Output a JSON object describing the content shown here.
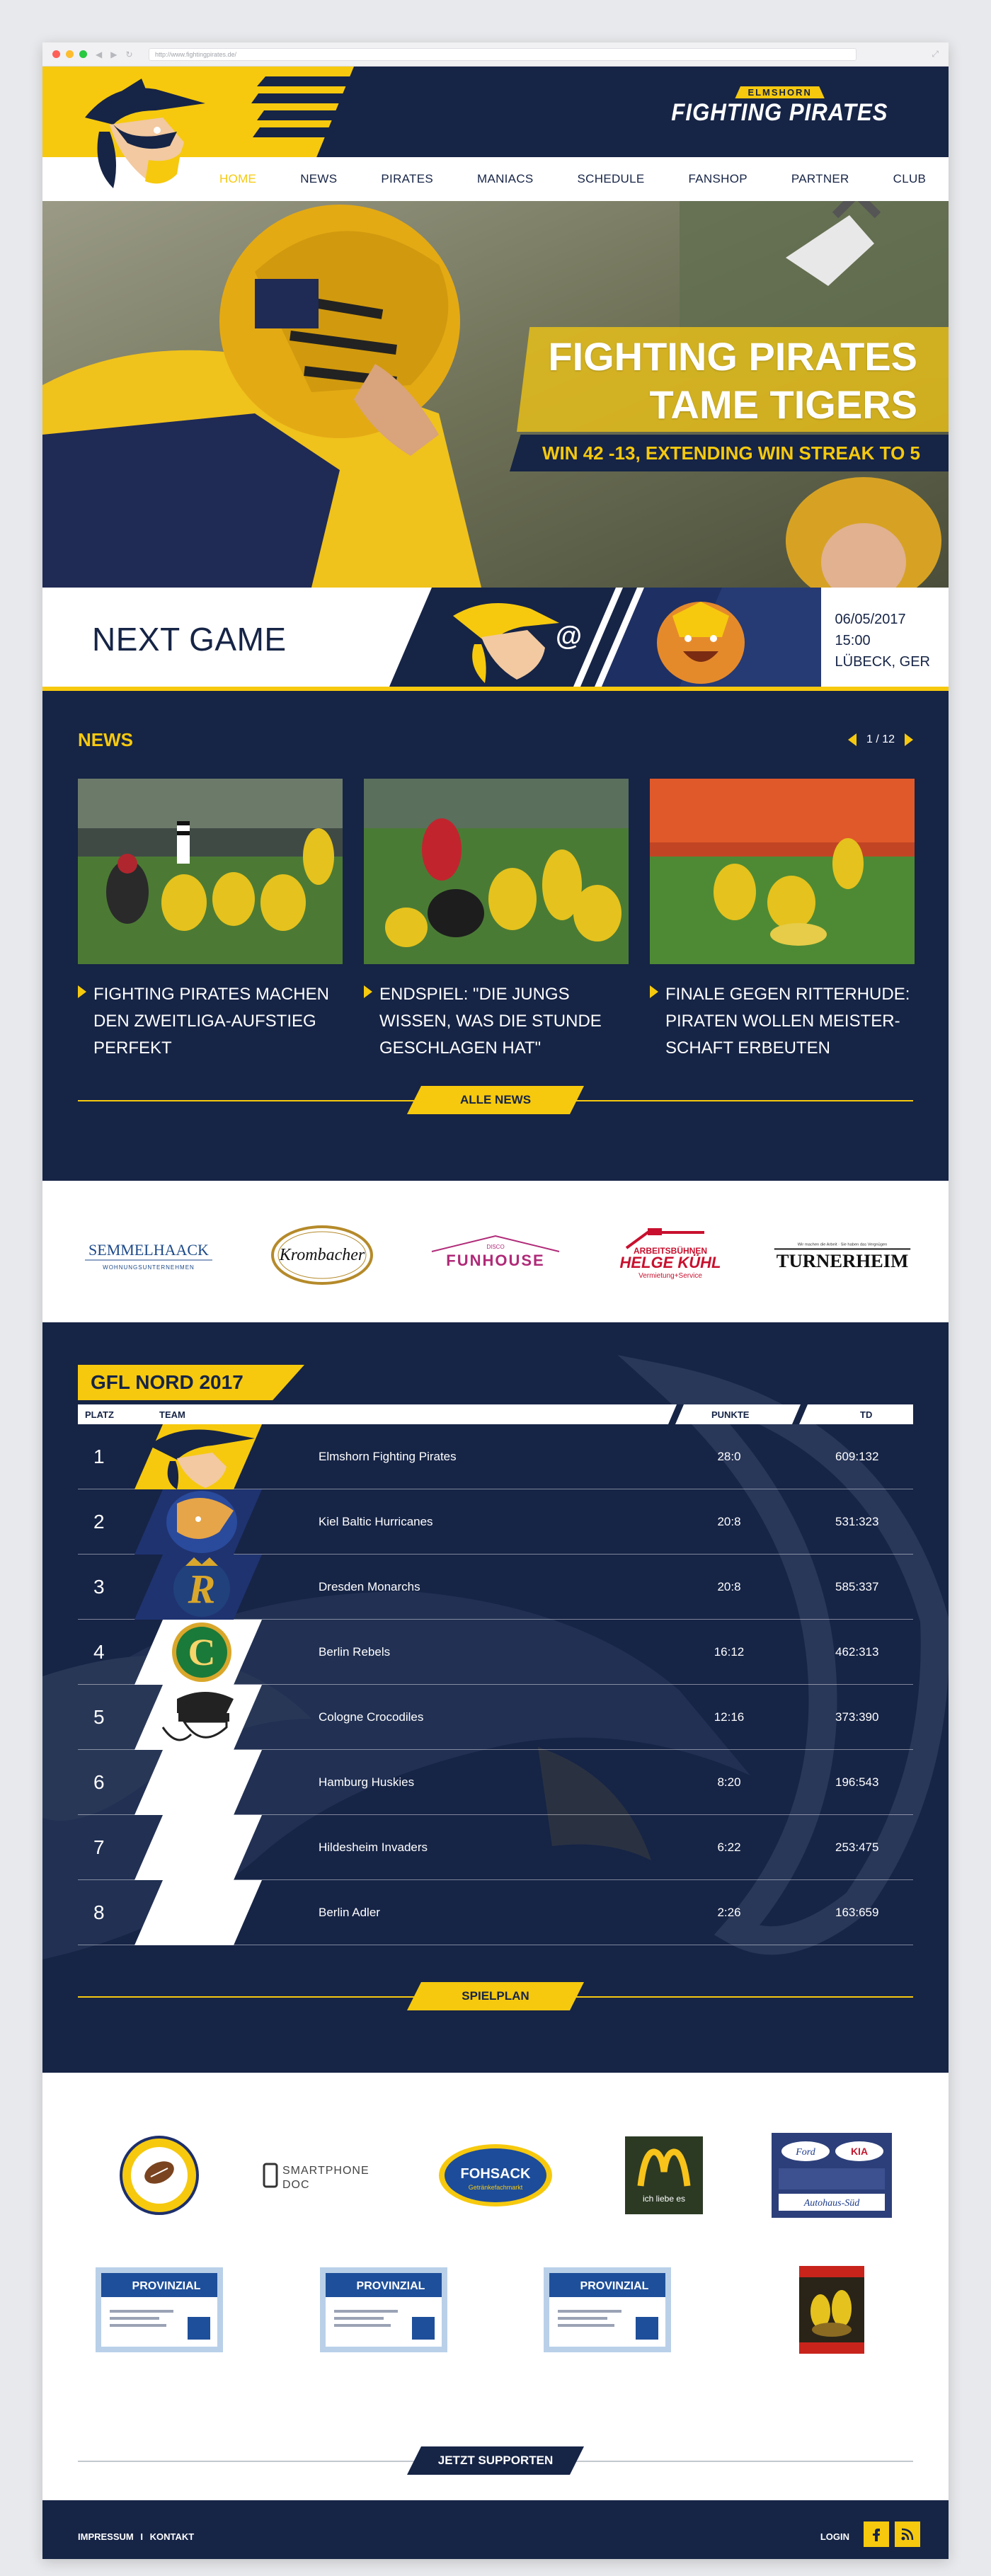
{
  "browser": {
    "url": "http://www.fightingpirates.de/"
  },
  "brand": {
    "top": "ELMSHORN",
    "main": "FIGHTING PIRATES"
  },
  "nav": [
    "HOME",
    "NEWS",
    "PIRATES",
    "MANIACS",
    "SCHEDULE",
    "FANSHOP",
    "PARTNER",
    "CLUB"
  ],
  "hero": {
    "title_line1": "FIGHTING PIRATES",
    "title_line2": "TAME TIGERS",
    "subtitle": "WIN 42 -13, EXTENDING WIN STREAK TO 5"
  },
  "next_game": {
    "label": "NEXT GAME",
    "at": "@",
    "date": "06/05/2017",
    "time": "15:00",
    "location": "LÜBECK, GER"
  },
  "news": {
    "heading": "NEWS",
    "pager": "1 / 12",
    "items": [
      {
        "title": "FIGHTING PIRATES MACHEN DEN ZWEITLIGA-AUFSTIEG PERFEKT"
      },
      {
        "title": "ENDSPIEL: \"DIE JUNGS WISSEN, WAS DIE STUNDE GESCHLAGEN HAT\""
      },
      {
        "title": "FINALE GEGEN RITTERHUDE: PIRATEN WOLLEN MEISTER-SCHAFT ERBEUTEN"
      }
    ],
    "more_button": "ALLE NEWS"
  },
  "sponsors": {
    "logos": [
      "SEMMELHAACK",
      "Krombacher",
      "FUNHOUSE",
      "HELGE KÜHL",
      "TURNERHEIM"
    ],
    "semmelhaack_sub": "WOHNUNGSUNTERNEHMEN",
    "funhouse_sub": "DISCO",
    "kuhl_top": "ARBEITSBÜHNEN",
    "kuhl_sub": "Vermietung+Service",
    "turnerheim_sub": "Wir machen die Arbeit · Sie haben das Vergnügen"
  },
  "league": {
    "title": "GFL NORD 2017",
    "headers": {
      "rank": "PLATZ",
      "team": "TEAM",
      "points": "PUNKTE",
      "td": "TD"
    },
    "rows": [
      {
        "rank": "1",
        "team": "Elmshorn Fighting Pirates",
        "points": "28:0",
        "td": "609:132"
      },
      {
        "rank": "2",
        "team": "Kiel Baltic Hurricanes",
        "points": "20:8",
        "td": "531:323"
      },
      {
        "rank": "3",
        "team": "Dresden Monarchs",
        "points": "20:8",
        "td": "585:337"
      },
      {
        "rank": "4",
        "team": "Berlin Rebels",
        "points": "16:12",
        "td": "462:313"
      },
      {
        "rank": "5",
        "team": "Cologne Crocodiles",
        "points": "12:16",
        "td": "373:390"
      },
      {
        "rank": "6",
        "team": "Hamburg Huskies",
        "points": "8:20",
        "td": "196:543"
      },
      {
        "rank": "7",
        "team": "Hildesheim Invaders",
        "points": "6:22",
        "td": "253:475"
      },
      {
        "rank": "8",
        "team": "Berlin Adler",
        "points": "2:26",
        "td": "163:659"
      }
    ],
    "schedule_button": "SPIELPLAN"
  },
  "supporters": {
    "row1": [
      "SMARTPHONE",
      "DOC",
      "FOHSACK",
      "Getränkefachmarkt",
      "ich liebe es",
      "Ford",
      "KIA",
      "Autohaus-Süd"
    ],
    "provinzial": "PROVINZIAL",
    "support_button": "JETZT SUPPORTEN"
  },
  "footer": {
    "impressum": "IMPRESSUM",
    "sep": "I",
    "kontakt": "KONTAKT",
    "login": "LOGIN"
  },
  "colors": {
    "navy": "#162446",
    "yellow": "#f6c90e"
  }
}
